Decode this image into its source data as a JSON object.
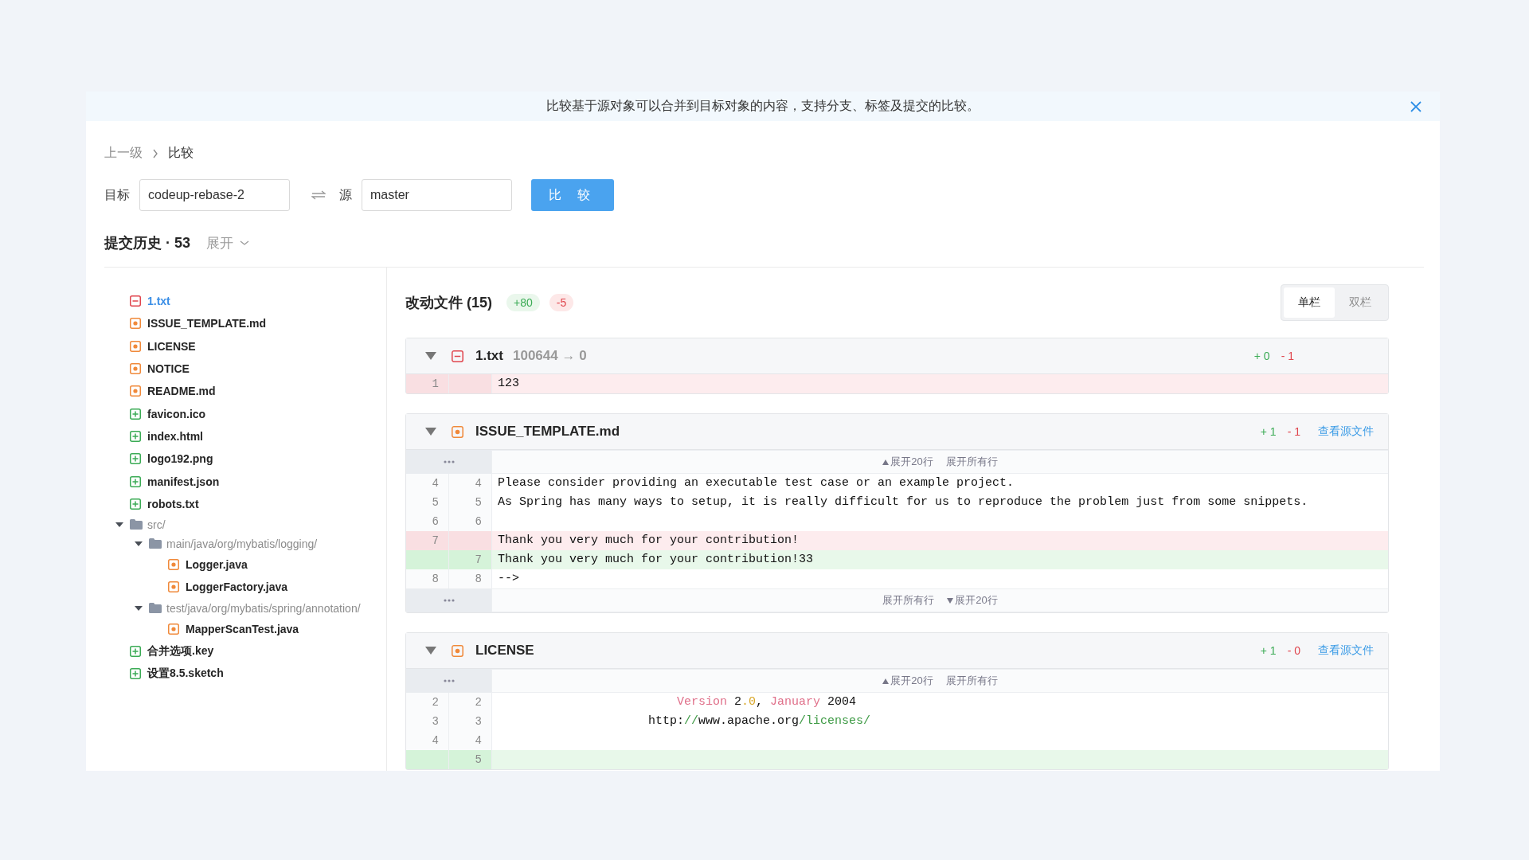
{
  "banner": {
    "text": "比较基于源对象可以合并到目标对象的内容，支持分支、标签及提交的比较。"
  },
  "breadcrumb": [
    {
      "label": "上一级"
    },
    {
      "label": "比较"
    }
  ],
  "compare": {
    "target_label": "目标",
    "target_value": "codeup-rebase-2",
    "source_label": "源",
    "source_value": "master",
    "button": "比 较"
  },
  "history": {
    "title": "提交历史 · 53",
    "expand": "展开"
  },
  "tree": [
    {
      "name": "1.txt",
      "kind": "deleted",
      "selected": true
    },
    {
      "name": "ISSUE_TEMPLATE.md",
      "kind": "modified",
      "selected": false
    },
    {
      "name": "LICENSE",
      "kind": "modified",
      "selected": false
    },
    {
      "name": "NOTICE",
      "kind": "modified",
      "selected": false
    },
    {
      "name": "README.md",
      "kind": "modified",
      "selected": false
    },
    {
      "name": "favicon.ico",
      "kind": "added",
      "selected": false
    },
    {
      "name": "index.html",
      "kind": "added",
      "selected": false
    },
    {
      "name": "logo192.png",
      "kind": "added",
      "selected": false
    },
    {
      "name": "manifest.json",
      "kind": "added",
      "selected": false
    },
    {
      "name": "robots.txt",
      "kind": "added",
      "selected": false
    },
    {
      "name": "src/",
      "kind": "folder",
      "expanded": true,
      "children": [
        {
          "name": "main/java/org/mybatis/logging/",
          "kind": "folder",
          "expanded": true,
          "children": [
            {
              "name": "Logger.java",
              "kind": "modified",
              "selected": false
            },
            {
              "name": "LoggerFactory.java",
              "kind": "modified",
              "selected": false
            }
          ]
        },
        {
          "name": "test/java/org/mybatis/spring/annotation/",
          "kind": "folder",
          "expanded": true,
          "children": [
            {
              "name": "MapperScanTest.java",
              "kind": "modified",
              "selected": false
            }
          ]
        }
      ]
    },
    {
      "name": "合并选项.key",
      "kind": "added",
      "selected": false
    },
    {
      "name": "设置8.5.sketch",
      "kind": "added",
      "selected": false
    }
  ],
  "changes": {
    "title": "改动文件 (15)",
    "added": "+80",
    "removed": "-5",
    "view_modes": [
      {
        "label": "单栏",
        "selected": true
      },
      {
        "label": "双栏",
        "selected": false
      }
    ]
  },
  "files": [
    {
      "name": "1.txt",
      "kind": "deleted",
      "mode": "100644 → 0",
      "expanded": true,
      "added": "+ 0",
      "removed": "- 1",
      "rows": [
        {
          "kind": "del",
          "old": "1",
          "code": "123"
        }
      ]
    },
    {
      "name": "ISSUE_TEMPLATE.md",
      "kind": "modified",
      "expanded": true,
      "added": "+ 1",
      "removed": "- 1",
      "link": "查看源文件",
      "rows": [
        {
          "kind": "expand",
          "actions": [
            {
              "label": "展开20行",
              "kind": "expand_up"
            },
            {
              "label": "展开所有行",
              "kind": "expand_all"
            }
          ]
        },
        {
          "kind": "context",
          "old": "4",
          "new": "4",
          "code": "Please consider providing an executable test case or an example project."
        },
        {
          "kind": "context",
          "old": "5",
          "new": "5",
          "code": "As Spring has many ways to setup, it is really difficult for us to reproduce the problem just from some snippets."
        },
        {
          "kind": "context",
          "old": "6",
          "new": "6"
        },
        {
          "kind": "del",
          "old": "7",
          "code": "Thank you very much for your contribution!"
        },
        {
          "kind": "add",
          "new": "7",
          "code": "Thank you very much for your contribution!33"
        },
        {
          "kind": "context",
          "old": "8",
          "new": "8",
          "code": "-->"
        },
        {
          "kind": "expand",
          "actions": [
            {
              "label": "展开所有行",
              "kind": "expand_all"
            },
            {
              "label": "展开20行",
              "kind": "expand_down"
            }
          ]
        }
      ]
    },
    {
      "name": "LICENSE",
      "kind": "modified",
      "expanded": true,
      "added": "+ 1",
      "removed": "- 0",
      "link": "查看源文件",
      "rows": [
        {
          "kind": "expand",
          "actions": [
            {
              "label": "展开20行",
              "kind": "expand_up"
            },
            {
              "label": "展开所有行",
              "kind": "expand_all"
            }
          ]
        },
        {
          "kind": "context",
          "old": "2",
          "new": "2",
          "segments": [
            {
              "text": "                         Version",
              "kind": "keyword"
            },
            {
              "text": " 2",
              "kind": "plain"
            },
            {
              "text": ".0",
              "kind": "number"
            },
            {
              "text": ", ",
              "kind": "plain"
            },
            {
              "text": "January",
              "kind": "keyword"
            },
            {
              "text": " 2004",
              "kind": "plain"
            }
          ]
        },
        {
          "kind": "context",
          "old": "3",
          "new": "3",
          "segments": [
            {
              "text": "                     http:",
              "kind": "plain"
            },
            {
              "text": "//",
              "kind": "string"
            },
            {
              "text": "www.apache.org",
              "kind": "plain"
            },
            {
              "text": "/licenses/",
              "kind": "string"
            }
          ]
        },
        {
          "kind": "context",
          "old": "4",
          "new": "4"
        },
        {
          "kind": "add",
          "new": "5"
        }
      ]
    }
  ]
}
